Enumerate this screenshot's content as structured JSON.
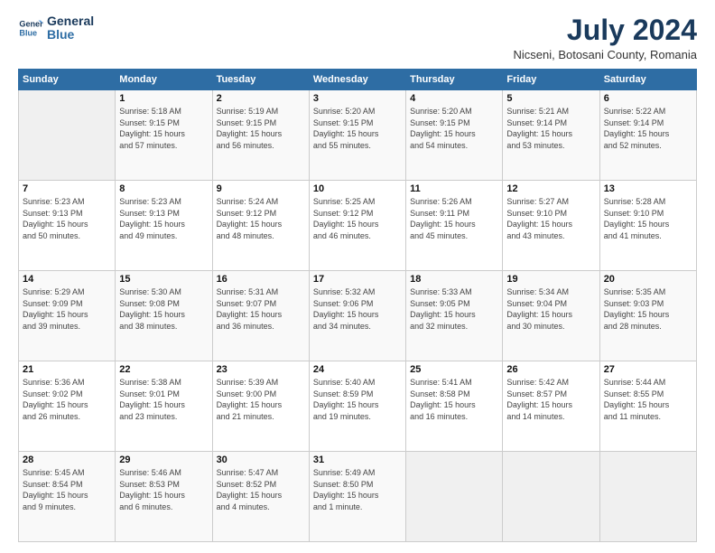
{
  "logo": {
    "line1": "General",
    "line2": "Blue"
  },
  "title": "July 2024",
  "subtitle": "Nicseni, Botosani County, Romania",
  "days_of_week": [
    "Sunday",
    "Monday",
    "Tuesday",
    "Wednesday",
    "Thursday",
    "Friday",
    "Saturday"
  ],
  "weeks": [
    [
      {
        "day": "",
        "content": ""
      },
      {
        "day": "1",
        "content": "Sunrise: 5:18 AM\nSunset: 9:15 PM\nDaylight: 15 hours\nand 57 minutes."
      },
      {
        "day": "2",
        "content": "Sunrise: 5:19 AM\nSunset: 9:15 PM\nDaylight: 15 hours\nand 56 minutes."
      },
      {
        "day": "3",
        "content": "Sunrise: 5:20 AM\nSunset: 9:15 PM\nDaylight: 15 hours\nand 55 minutes."
      },
      {
        "day": "4",
        "content": "Sunrise: 5:20 AM\nSunset: 9:15 PM\nDaylight: 15 hours\nand 54 minutes."
      },
      {
        "day": "5",
        "content": "Sunrise: 5:21 AM\nSunset: 9:14 PM\nDaylight: 15 hours\nand 53 minutes."
      },
      {
        "day": "6",
        "content": "Sunrise: 5:22 AM\nSunset: 9:14 PM\nDaylight: 15 hours\nand 52 minutes."
      }
    ],
    [
      {
        "day": "7",
        "content": "Sunrise: 5:23 AM\nSunset: 9:13 PM\nDaylight: 15 hours\nand 50 minutes."
      },
      {
        "day": "8",
        "content": "Sunrise: 5:23 AM\nSunset: 9:13 PM\nDaylight: 15 hours\nand 49 minutes."
      },
      {
        "day": "9",
        "content": "Sunrise: 5:24 AM\nSunset: 9:12 PM\nDaylight: 15 hours\nand 48 minutes."
      },
      {
        "day": "10",
        "content": "Sunrise: 5:25 AM\nSunset: 9:12 PM\nDaylight: 15 hours\nand 46 minutes."
      },
      {
        "day": "11",
        "content": "Sunrise: 5:26 AM\nSunset: 9:11 PM\nDaylight: 15 hours\nand 45 minutes."
      },
      {
        "day": "12",
        "content": "Sunrise: 5:27 AM\nSunset: 9:10 PM\nDaylight: 15 hours\nand 43 minutes."
      },
      {
        "day": "13",
        "content": "Sunrise: 5:28 AM\nSunset: 9:10 PM\nDaylight: 15 hours\nand 41 minutes."
      }
    ],
    [
      {
        "day": "14",
        "content": "Sunrise: 5:29 AM\nSunset: 9:09 PM\nDaylight: 15 hours\nand 39 minutes."
      },
      {
        "day": "15",
        "content": "Sunrise: 5:30 AM\nSunset: 9:08 PM\nDaylight: 15 hours\nand 38 minutes."
      },
      {
        "day": "16",
        "content": "Sunrise: 5:31 AM\nSunset: 9:07 PM\nDaylight: 15 hours\nand 36 minutes."
      },
      {
        "day": "17",
        "content": "Sunrise: 5:32 AM\nSunset: 9:06 PM\nDaylight: 15 hours\nand 34 minutes."
      },
      {
        "day": "18",
        "content": "Sunrise: 5:33 AM\nSunset: 9:05 PM\nDaylight: 15 hours\nand 32 minutes."
      },
      {
        "day": "19",
        "content": "Sunrise: 5:34 AM\nSunset: 9:04 PM\nDaylight: 15 hours\nand 30 minutes."
      },
      {
        "day": "20",
        "content": "Sunrise: 5:35 AM\nSunset: 9:03 PM\nDaylight: 15 hours\nand 28 minutes."
      }
    ],
    [
      {
        "day": "21",
        "content": "Sunrise: 5:36 AM\nSunset: 9:02 PM\nDaylight: 15 hours\nand 26 minutes."
      },
      {
        "day": "22",
        "content": "Sunrise: 5:38 AM\nSunset: 9:01 PM\nDaylight: 15 hours\nand 23 minutes."
      },
      {
        "day": "23",
        "content": "Sunrise: 5:39 AM\nSunset: 9:00 PM\nDaylight: 15 hours\nand 21 minutes."
      },
      {
        "day": "24",
        "content": "Sunrise: 5:40 AM\nSunset: 8:59 PM\nDaylight: 15 hours\nand 19 minutes."
      },
      {
        "day": "25",
        "content": "Sunrise: 5:41 AM\nSunset: 8:58 PM\nDaylight: 15 hours\nand 16 minutes."
      },
      {
        "day": "26",
        "content": "Sunrise: 5:42 AM\nSunset: 8:57 PM\nDaylight: 15 hours\nand 14 minutes."
      },
      {
        "day": "27",
        "content": "Sunrise: 5:44 AM\nSunset: 8:55 PM\nDaylight: 15 hours\nand 11 minutes."
      }
    ],
    [
      {
        "day": "28",
        "content": "Sunrise: 5:45 AM\nSunset: 8:54 PM\nDaylight: 15 hours\nand 9 minutes."
      },
      {
        "day": "29",
        "content": "Sunrise: 5:46 AM\nSunset: 8:53 PM\nDaylight: 15 hours\nand 6 minutes."
      },
      {
        "day": "30",
        "content": "Sunrise: 5:47 AM\nSunset: 8:52 PM\nDaylight: 15 hours\nand 4 minutes."
      },
      {
        "day": "31",
        "content": "Sunrise: 5:49 AM\nSunset: 8:50 PM\nDaylight: 15 hours\nand 1 minute."
      },
      {
        "day": "",
        "content": ""
      },
      {
        "day": "",
        "content": ""
      },
      {
        "day": "",
        "content": ""
      }
    ]
  ]
}
